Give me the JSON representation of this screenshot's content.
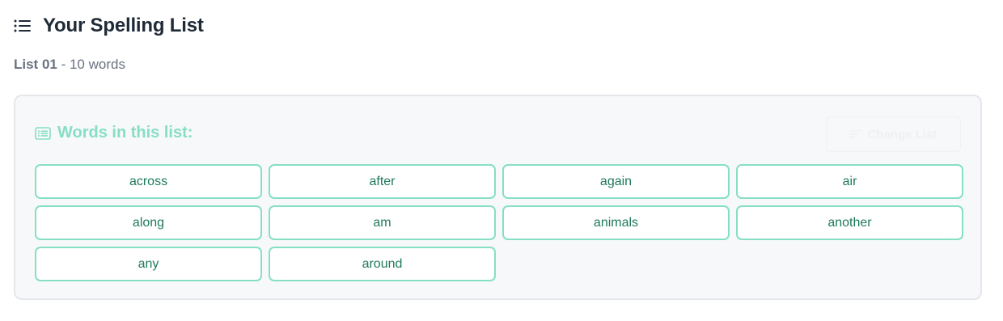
{
  "header": {
    "title": "Your Spelling List"
  },
  "subtitle": {
    "list_name": "List 01",
    "separator": " - ",
    "word_count": "10 words"
  },
  "panel": {
    "title": "Words in this list:",
    "change_button_label": "Change List"
  },
  "words": [
    "across",
    "after",
    "again",
    "air",
    "along",
    "am",
    "animals",
    "another",
    "any",
    "around"
  ],
  "icons": {
    "header_icon": "list-icon",
    "panel_icon": "document-list-icon",
    "change_button_icon": "sort-icon"
  },
  "colors": {
    "accent": "#86dfc4",
    "word_text": "#1f7a5c",
    "title_text": "#1f2a37"
  }
}
